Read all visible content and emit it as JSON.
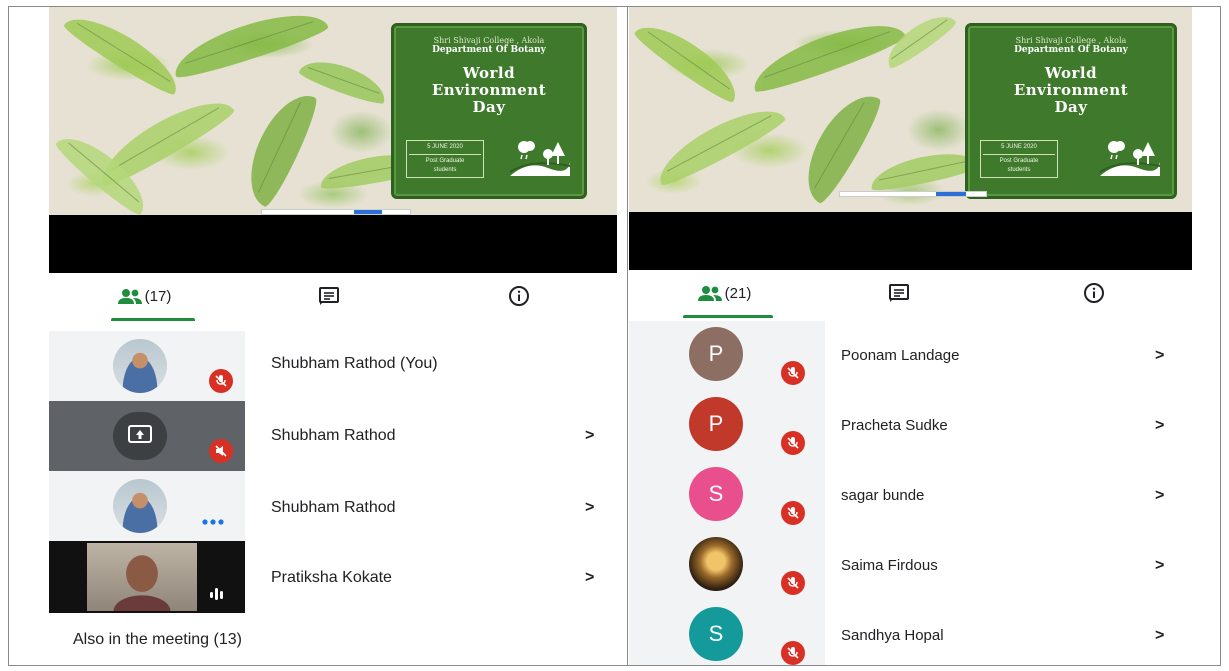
{
  "slide": {
    "college": "Shri Shivaji College , Akola",
    "department": "Department Of Botany",
    "title_line1": "World",
    "title_line2": "Environment",
    "title_line3": "Day",
    "date": "5 JUNE 2020",
    "info_line1": "Post Graduate",
    "info_line2": "students"
  },
  "left": {
    "participants_count": "(17)",
    "participants": [
      {
        "name": "Shubham Rathod (You)",
        "avatar": "photo",
        "status": "mic-off"
      },
      {
        "name": "Shubham Rathod",
        "avatar": "screen-share-icon",
        "status": "mic-off"
      },
      {
        "name": "Shubham Rathod",
        "avatar": "photo",
        "status": "more-dots"
      },
      {
        "name": "Pratiksha Kokate",
        "avatar": "video",
        "status": "speaking"
      }
    ],
    "chevron": ">",
    "also_in_meeting": "Also in the meeting (13)"
  },
  "right": {
    "participants_count": "(21)",
    "participants": [
      {
        "name": "Poonam Landage",
        "letter": "P",
        "color": "#8d6e63"
      },
      {
        "name": "Pracheta Sudke",
        "letter": "P",
        "color": "#c0392b"
      },
      {
        "name": "sagar bunde",
        "letter": "S",
        "color": "#e84f8c"
      },
      {
        "name": "Saima Firdous",
        "letter": "",
        "color": "#3b2a1a"
      },
      {
        "name": "Sandhya Hopal",
        "letter": "S",
        "color": "#159a9c"
      }
    ],
    "chevron": ">"
  },
  "colors": {
    "accent_green": "#1e8e3e",
    "mic_off_red": "#d93025",
    "banner_green": "#3f7a2c"
  }
}
